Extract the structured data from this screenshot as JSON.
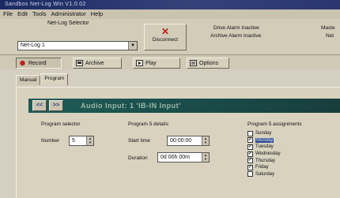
{
  "window": {
    "title": "Sandbox Net-Log Win V1.0.02"
  },
  "menu": [
    "File",
    "Edit",
    "Tools",
    "Administrator",
    "Help"
  ],
  "toolbar": {
    "selector_label": "Net-Log Selector",
    "selector_value": "Net-Log 1",
    "disconnect_label": "Disconnect",
    "drive_alarm": "Drive Alarm Inactive",
    "archive_alarm": "Archive Alarm Inactive",
    "right_top": "Maste",
    "right_bottom": "Net"
  },
  "modes": [
    {
      "label": "Record",
      "active": true
    },
    {
      "label": "Archive",
      "active": false
    },
    {
      "label": "Play",
      "active": false
    },
    {
      "label": "Options",
      "active": false
    }
  ],
  "subtabs": [
    {
      "label": "Manual",
      "active": false
    },
    {
      "label": "Program",
      "active": true
    }
  ],
  "nav": {
    "prev": "<<",
    "next": ">>",
    "title": "Audio Input: 1 'IB-IN Input'"
  },
  "program_selector": {
    "title": "Program selector",
    "number_label": "Number",
    "number_value": "5"
  },
  "program_details": {
    "title": "Program 5 details",
    "start_label": "Start time",
    "start_value": "00:00:00",
    "duration_label": "Duration",
    "duration_value": "0d 00h 00m"
  },
  "assignments": {
    "title": "Program 5 assignments",
    "days": [
      {
        "label": "Sunday",
        "checked": false,
        "highlight": false
      },
      {
        "label": "Monday",
        "checked": true,
        "highlight": true
      },
      {
        "label": "Tuesday",
        "checked": true,
        "highlight": false
      },
      {
        "label": "Wednesday",
        "checked": true,
        "highlight": false
      },
      {
        "label": "Thursday",
        "checked": true,
        "highlight": false
      },
      {
        "label": "Friday",
        "checked": true,
        "highlight": false
      },
      {
        "label": "Saturday",
        "checked": false,
        "highlight": false
      }
    ]
  },
  "colors": {
    "accent_nav": "#1a4d4a",
    "title_bar": "#1c2a63",
    "disconnect_x": "#c0201a"
  }
}
